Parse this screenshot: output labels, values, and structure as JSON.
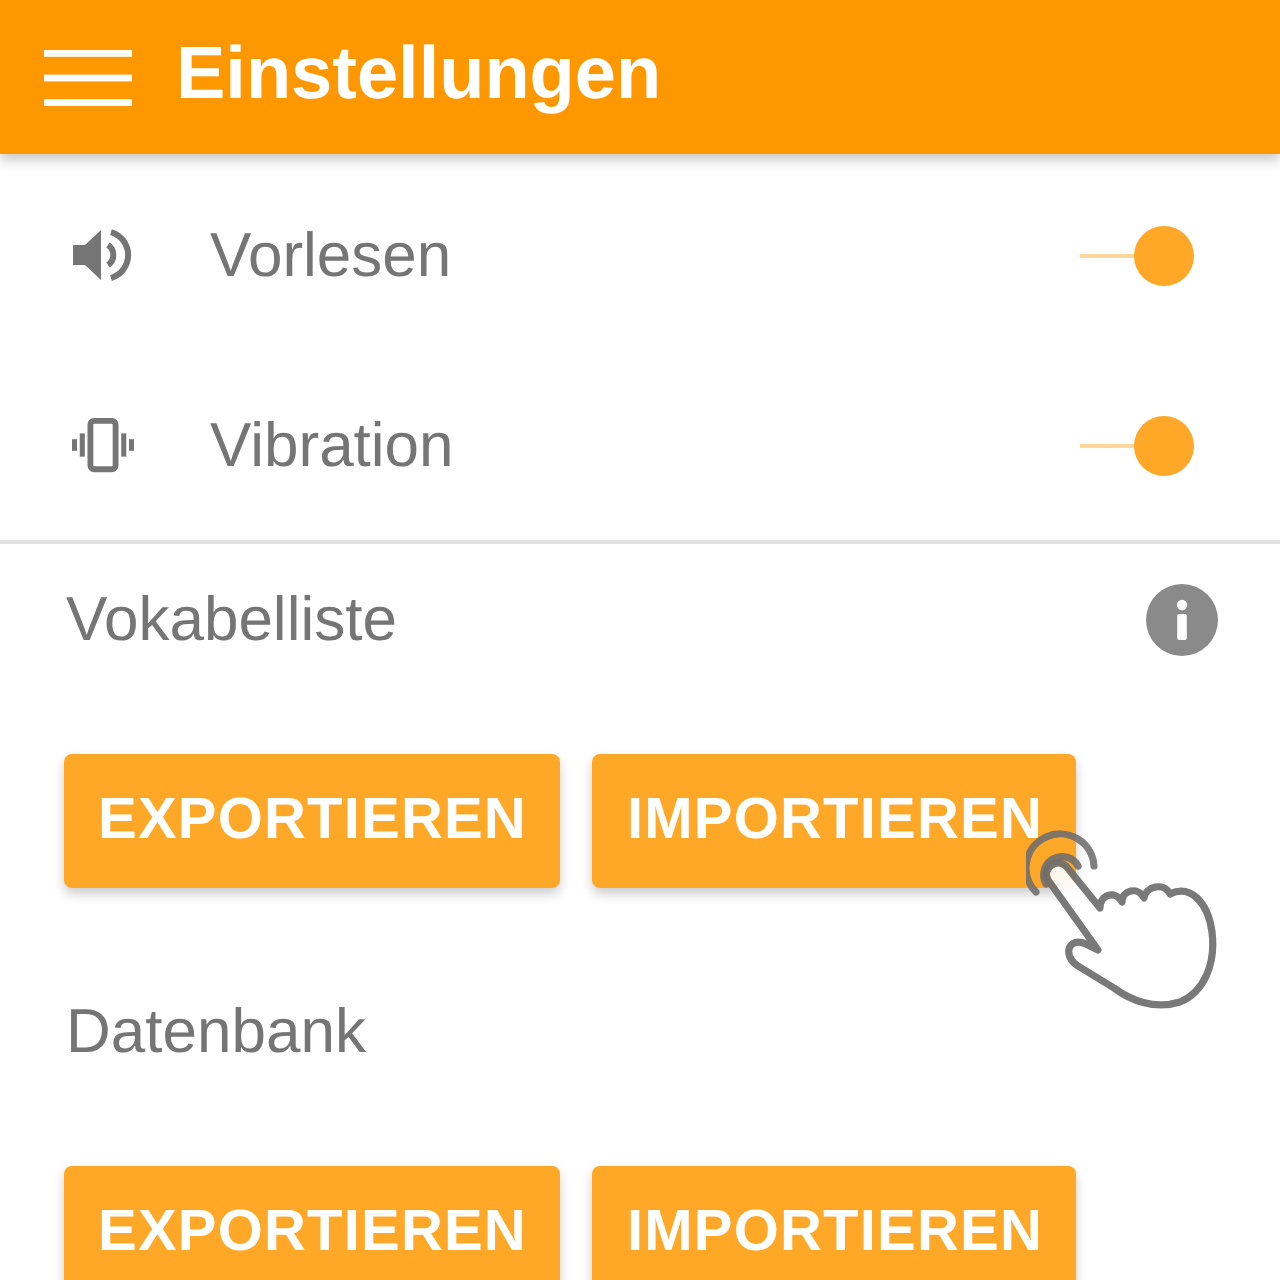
{
  "app_bar": {
    "title": "Einstellungen"
  },
  "settings": [
    {
      "label": "Vorlesen",
      "on": true
    },
    {
      "label": "Vibration",
      "on": true
    }
  ],
  "sections": [
    {
      "title": "Vokabelliste",
      "info": true,
      "buttons": [
        {
          "label": "EXPORTIEREN",
          "tapped": false
        },
        {
          "label": "IMPORTIEREN",
          "tapped": true
        }
      ]
    },
    {
      "title": "Datenbank",
      "info": false,
      "buttons": [
        {
          "label": "EXPORTIEREN",
          "tapped": false
        },
        {
          "label": "IMPORTIEREN",
          "tapped": false
        }
      ]
    }
  ]
}
